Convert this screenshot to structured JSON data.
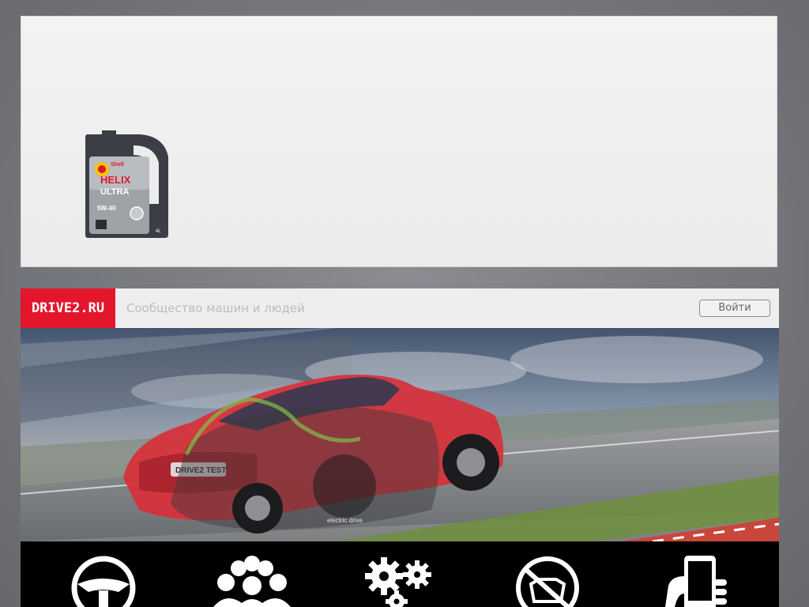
{
  "ad": {
    "product_brand": "Shell",
    "product_line_1": "HELIX",
    "product_line_2": "ULTRA",
    "product_grade": "5W-40",
    "product_volume": "4L"
  },
  "header": {
    "logo_text": "DRIVE2.RU",
    "tagline": "Сообщество машин и людей",
    "login_label": "Войти"
  },
  "hero": {
    "car_plate_text": "DRIVE2 TEST",
    "car_badge_text": "electric drive"
  },
  "features": [
    {
      "icon": "steering-wheel-icon"
    },
    {
      "icon": "community-people-icon"
    },
    {
      "icon": "gears-icon"
    },
    {
      "icon": "no-ads-icon"
    },
    {
      "icon": "mobile-phone-icon"
    }
  ],
  "colors": {
    "brand_red": "#e3162c",
    "topbar_bg": "#eeeeee",
    "features_bg": "#000000"
  }
}
